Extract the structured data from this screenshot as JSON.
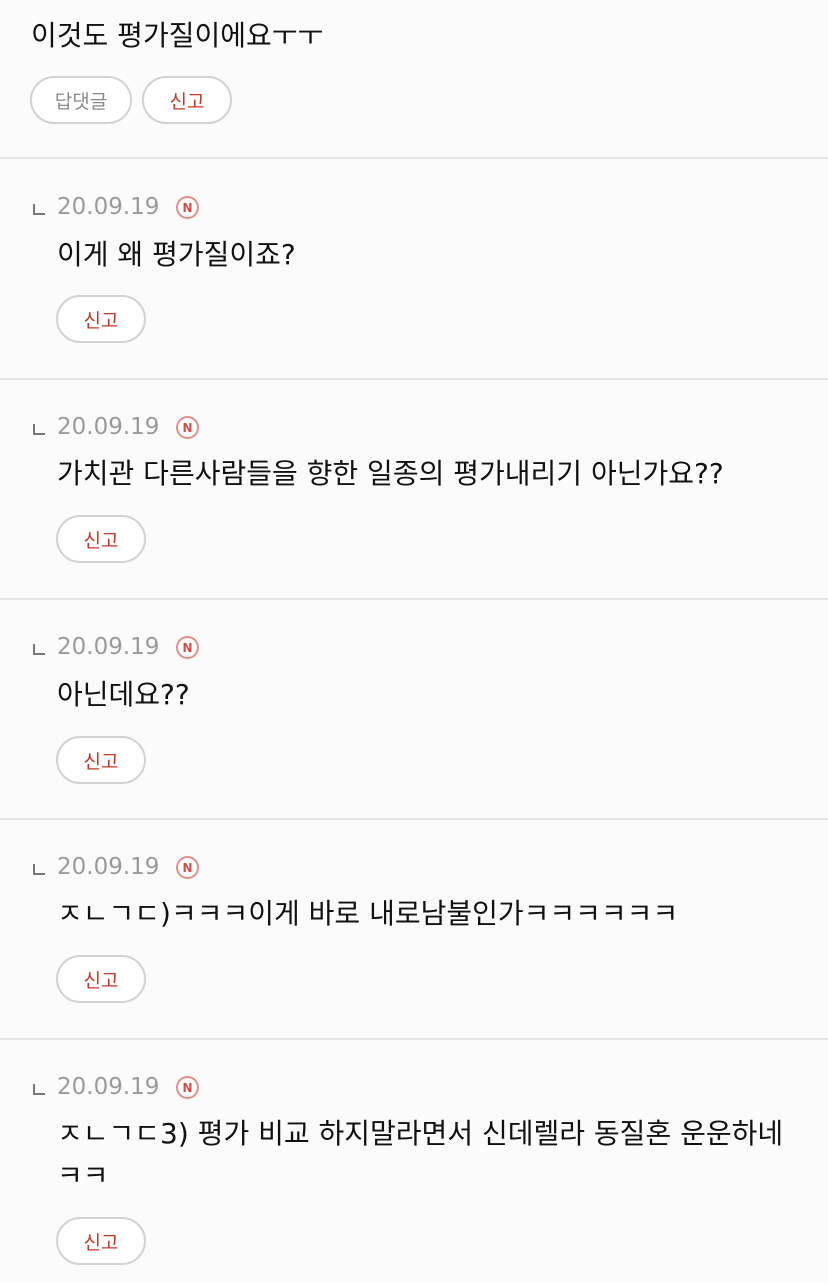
{
  "top_comment": {
    "text": "이것도 평가질이에요ㅜㅜ",
    "reply_label": "답댓글",
    "report_label": "신고"
  },
  "replies": [
    {
      "date": "20.09.19",
      "badge": "N",
      "text": "이게 왜 평가질이죠?",
      "report_label": "신고"
    },
    {
      "date": "20.09.19",
      "badge": "N",
      "text": "가치관 다른사람들을 향한 일종의 평가내리기 아닌가요??",
      "report_label": "신고"
    },
    {
      "date": "20.09.19",
      "badge": "N",
      "text": "아닌데요??",
      "report_label": "신고"
    },
    {
      "date": "20.09.19",
      "badge": "N",
      "text": "ㅈㄴㄱㄷ)ㅋㅋㅋ이게 바로 내로남불인가ㅋㅋㅋㅋㅋㅋ",
      "report_label": "신고"
    },
    {
      "date": "20.09.19",
      "badge": "N",
      "text": "ㅈㄴㄱㄷ3) 평가 비교 하지말라면서 신데렐라 동질혼 운운하네 ㅋㅋ",
      "report_label": "신고"
    }
  ],
  "colors": {
    "report_text": "#c0392b",
    "badge": "#d24c43",
    "divider": "#e6e6e6",
    "date": "#9a9a9a"
  }
}
